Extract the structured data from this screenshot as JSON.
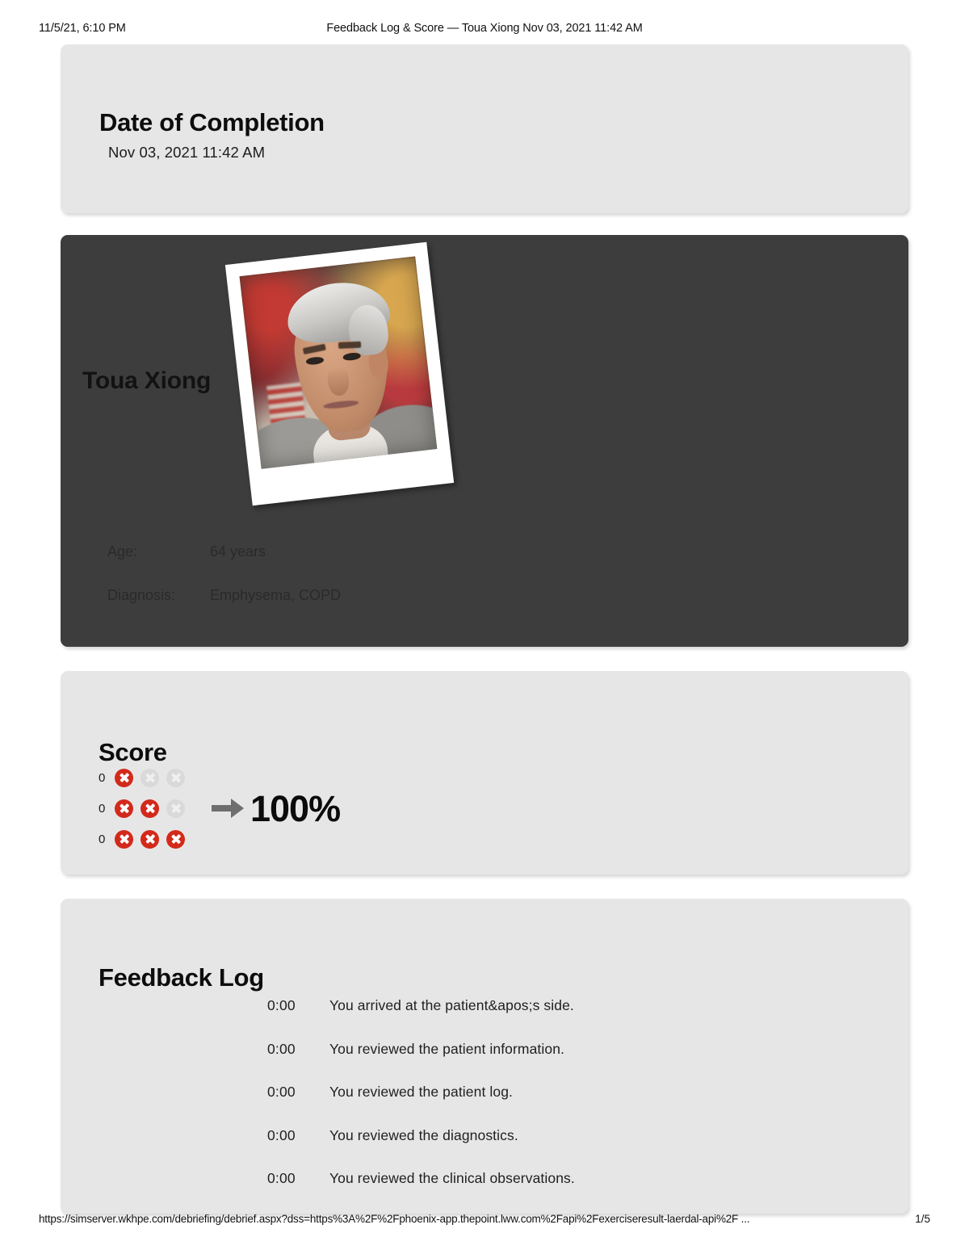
{
  "print_header": {
    "left": "11/5/21, 6:10 PM",
    "center": "Feedback Log & Score — Toua Xiong Nov 03, 2021 11:42 AM"
  },
  "date_card": {
    "title": "Date of Completion",
    "value": "Nov 03, 2021 11:42 AM"
  },
  "patient_card": {
    "name": "Toua Xiong",
    "photo_icon": "patient-portrait-polaroid",
    "meta": [
      {
        "label": "Age:",
        "value": "64 years"
      },
      {
        "label": "Diagnosis:",
        "value": "Emphysema, COPD"
      }
    ]
  },
  "score_card": {
    "title": "Score",
    "arrow_icon": "arrow-right-icon",
    "percent": "100%",
    "colors": {
      "marked": "#d3291b",
      "unmarked": "#d9d9d9",
      "arrow": "#6e6e6e"
    },
    "rows": [
      {
        "count": "0",
        "dots": [
          "on",
          "off",
          "off"
        ]
      },
      {
        "count": "0",
        "dots": [
          "on",
          "on",
          "off"
        ]
      },
      {
        "count": "0",
        "dots": [
          "on",
          "on",
          "on"
        ]
      }
    ]
  },
  "feedback_card": {
    "title": "Feedback Log",
    "entries": [
      {
        "time": "0:00",
        "message": "You arrived at the patient&apos;s side."
      },
      {
        "time": "0:00",
        "message": "You reviewed the patient information."
      },
      {
        "time": "0:00",
        "message": "You reviewed the patient log."
      },
      {
        "time": "0:00",
        "message": "You reviewed the diagnostics."
      },
      {
        "time": "0:00",
        "message": "You reviewed the clinical observations."
      }
    ]
  },
  "print_footer": {
    "url": "https://simserver.wkhpe.com/debriefing/debrief.aspx?dss=https%3A%2F%2Fphoenix-app.thepoint.lww.com%2Fapi%2Fexerciseresult-laerdal-api%2F ...",
    "page": "1/5"
  }
}
